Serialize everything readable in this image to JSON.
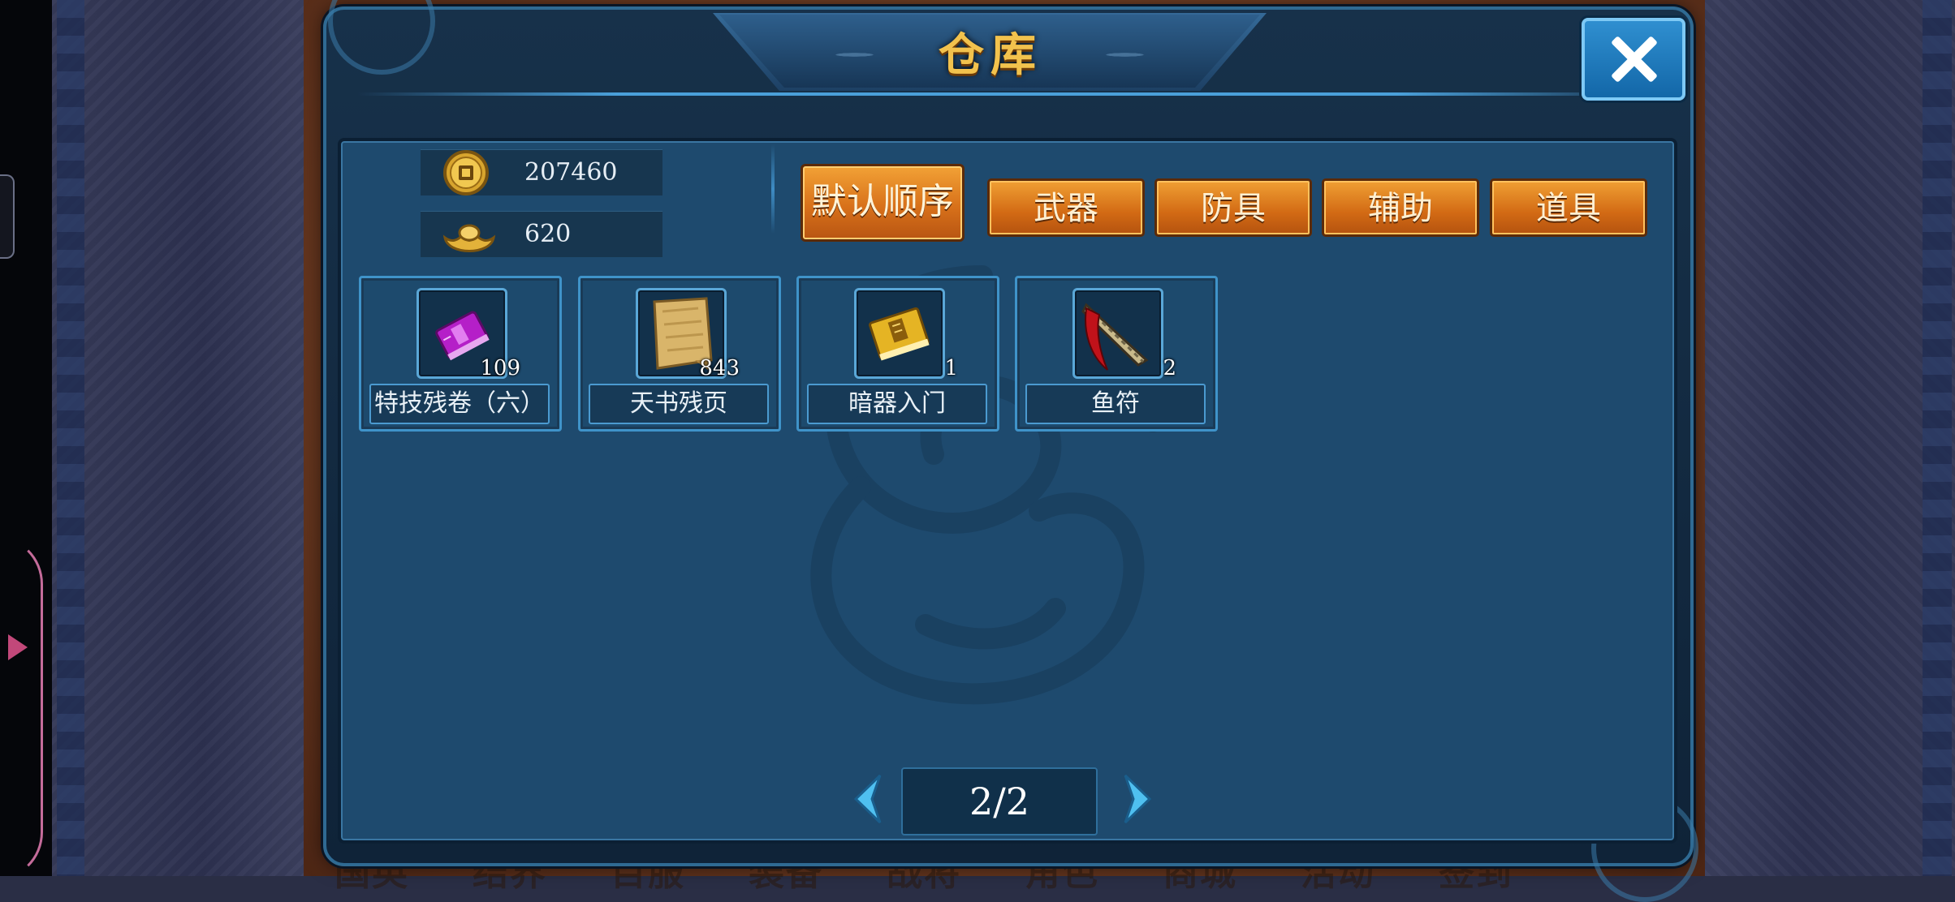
{
  "window": {
    "title": "仓库",
    "close_label": "close"
  },
  "currency": {
    "coins": {
      "icon": "copper-coin-icon",
      "value": "207460"
    },
    "ingots": {
      "icon": "gold-ingot-icon",
      "value": "620"
    }
  },
  "sort_button": {
    "label": "默认顺序"
  },
  "filters": [
    {
      "label": "武器"
    },
    {
      "label": "防具"
    },
    {
      "label": "辅助"
    },
    {
      "label": "道具"
    }
  ],
  "items": [
    {
      "name": "特技残卷（六）",
      "count": "109",
      "icon": "purple-book-icon"
    },
    {
      "name": "天书残页",
      "count": "843",
      "icon": "parchment-scroll-icon"
    },
    {
      "name": "暗器入门",
      "count": "1",
      "icon": "golden-manual-icon"
    },
    {
      "name": "鱼符",
      "count": "2",
      "icon": "fish-tally-icon"
    }
  ],
  "pagination": {
    "current": "2/2"
  },
  "background_menu": [
    "国英",
    "结界",
    "目服",
    "装备",
    "战将",
    "角色",
    "商城",
    "活动",
    "签到"
  ],
  "colors": {
    "button_orange": "#d8711a",
    "title_gold": "#f2c24d",
    "panel_blue": "#1e4a6e",
    "frame_blue": "#3f93c9"
  }
}
